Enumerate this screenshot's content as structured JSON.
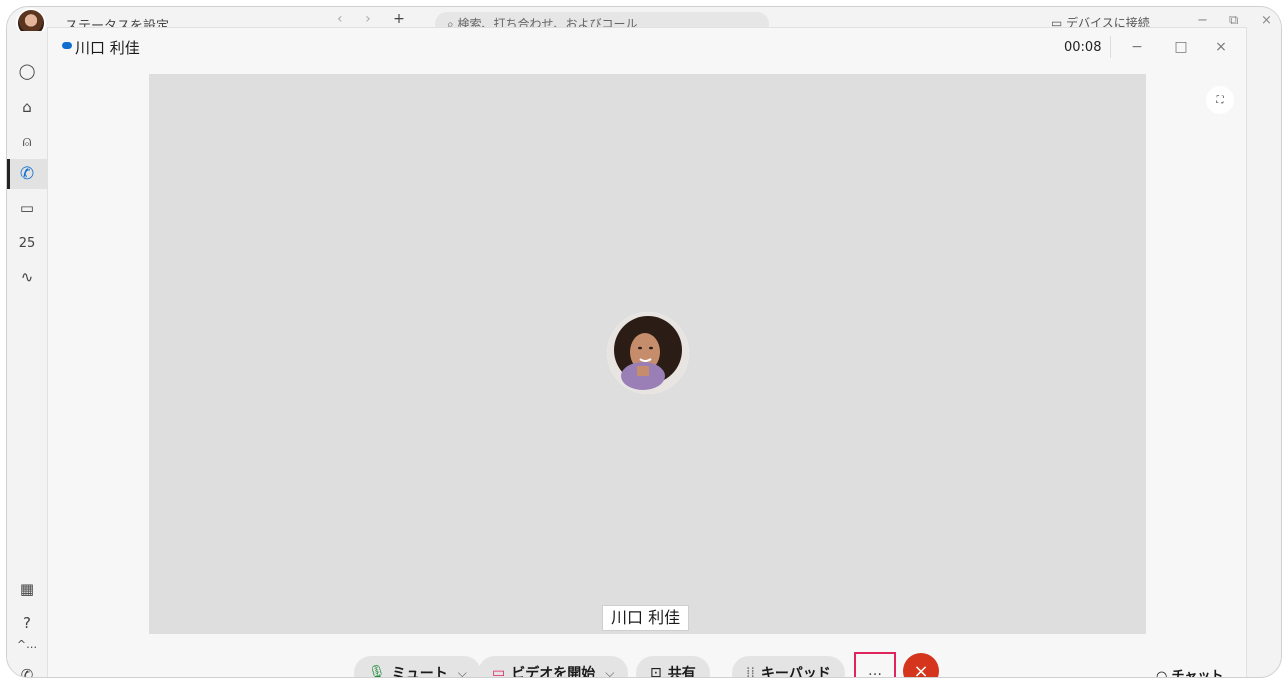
{
  "back_app": {
    "status_text": "ステータスを設定",
    "search_placeholder": "検索、打ち合わせ、およびコール",
    "connect_device": "デバイスに接続"
  },
  "sidebar": {
    "items": [
      {
        "icon": "chat-icon",
        "glyph": "◯"
      },
      {
        "icon": "teams-icon",
        "glyph": "♲"
      },
      {
        "icon": "contacts-icon",
        "glyph": "⍝"
      },
      {
        "icon": "calling-icon",
        "glyph": "✆"
      },
      {
        "icon": "voicemail-icon",
        "glyph": "▭"
      },
      {
        "icon": "calendar-icon",
        "glyph": "25"
      },
      {
        "icon": "analytics-icon",
        "glyph": "⌇"
      }
    ],
    "bottom": [
      {
        "icon": "apps-icon",
        "glyph": "▦"
      },
      {
        "icon": "help-icon",
        "glyph": "?"
      },
      {
        "icon": "more-icon",
        "glyph": "^..."
      }
    ]
  },
  "call_window": {
    "contact_name": "川口 利佳",
    "timer": "00:08",
    "minimize": "−",
    "maximize": "□",
    "close": "×",
    "name_tag": "川口 利佳"
  },
  "controls": {
    "mute_label": "ミュート",
    "video_label": "ビデオを開始",
    "share_label": "共有",
    "keypad_label": "キーパッド",
    "more_label": "…",
    "end_call": "×",
    "chat_label": "チャット"
  },
  "colors": {
    "end_call": "#d4351c",
    "highlight": "#e0245e",
    "presence": "#1170cf"
  }
}
